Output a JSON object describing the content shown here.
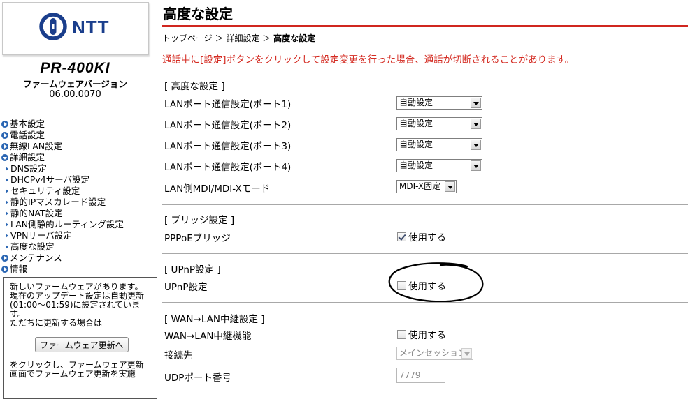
{
  "sidebar": {
    "logo_text": "NTT",
    "model": "PR-400KI",
    "firmware_label": "ファームウェアバージョン",
    "firmware_version": "06.00.0070",
    "menu": {
      "basic": "基本設定",
      "phone": "電話設定",
      "wlan": "無線LAN設定",
      "advanced": "詳細設定",
      "sub": [
        "DNS設定",
        "DHCPv4サーバ設定",
        "セキュリティ設定",
        "静的IPマスカレード設定",
        "静的NAT設定",
        "LAN側静的ルーティング設定",
        "VPNサーバ設定",
        "高度な設定"
      ],
      "maintenance": "メンテナンス",
      "info": "情報"
    },
    "notice": {
      "line1": "新しいファームウェアがあります。",
      "line2": "現在のアップデート設定は自動更新(01:00～01:59)に設定されています。",
      "line3": "ただちに更新する場合は",
      "button": "ファームウェア更新へ",
      "line4": "をクリックし、ファームウェア更新画面でファームウェア更新を実施"
    }
  },
  "main": {
    "title": "高度な設定",
    "breadcrumb": {
      "top": "トップページ",
      "sep1": "＞",
      "detail": "詳細設定",
      "sep2": "＞",
      "current": "高度な設定"
    },
    "warning": "通話中に[設定]ボタンをクリックして設定変更を行った場合、通話が切断されることがあります。",
    "advanced": {
      "header": "[ 高度な設定 ]",
      "rows": [
        {
          "label": "LANポート通信設定(ポート1)",
          "value": "自動設定"
        },
        {
          "label": "LANポート通信設定(ポート2)",
          "value": "自動設定"
        },
        {
          "label": "LANポート通信設定(ポート3)",
          "value": "自動設定"
        },
        {
          "label": "LANポート通信設定(ポート4)",
          "value": "自動設定"
        }
      ],
      "mdi_label": "LAN側MDI/MDI-Xモード",
      "mdi_value": "MDI-X固定"
    },
    "bridge": {
      "header": "[ ブリッジ設定 ]",
      "label": "PPPoEブリッジ",
      "checkbox": "使用する",
      "checked": true
    },
    "upnp": {
      "header": "[ UPnP設定 ]",
      "label": "UPnP設定",
      "checkbox": "使用する",
      "checked": false
    },
    "wan_relay": {
      "header": "[ WAN→LAN中継設定 ]",
      "label": "WAN→LAN中継機能",
      "checkbox": "使用する",
      "checked": false,
      "dest_label": "接続先",
      "dest_value": "メインセッション",
      "port_label": "UDPポート番号",
      "port_value": "7779"
    }
  },
  "colors": {
    "accent_red": "#d0261f",
    "warning_text": "#d42b22",
    "logo_blue": "#1a3e8c",
    "menu_bullet": "#2b66b3"
  }
}
